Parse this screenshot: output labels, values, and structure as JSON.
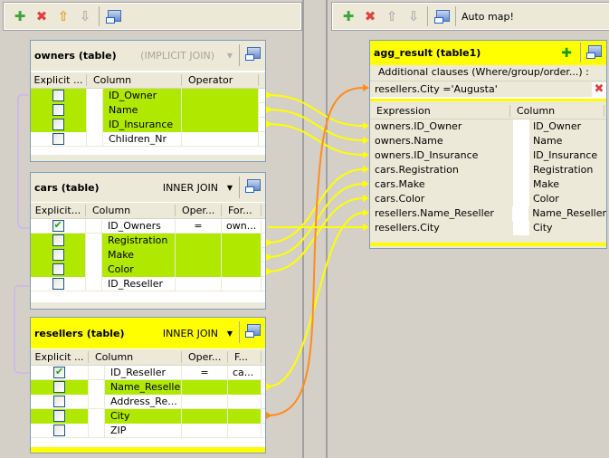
{
  "left_toolbar": {
    "buttons": [
      "add",
      "remove",
      "move-up",
      "move-down",
      "minimize"
    ]
  },
  "right_toolbar": {
    "auto_map": "Auto map!"
  },
  "tables": [
    {
      "id": "owners",
      "title": "owners  (table)",
      "join": "(IMPLICIT JOIN)",
      "join_disabled": true,
      "yellow": false,
      "headers": [
        "Explicit ...",
        "Column",
        "Operator"
      ],
      "rows": [
        {
          "checked": false,
          "column": "ID_Owner",
          "op": "",
          "for": "",
          "mapped": true
        },
        {
          "checked": false,
          "column": "Name",
          "op": "",
          "for": "",
          "mapped": true
        },
        {
          "checked": false,
          "column": "ID_Insurance",
          "op": "",
          "for": "",
          "mapped": true
        },
        {
          "checked": false,
          "column": "Chlidren_Nr",
          "op": "",
          "for": "",
          "mapped": false
        }
      ]
    },
    {
      "id": "cars",
      "title": "cars  (table)",
      "join": "INNER JOIN",
      "join_disabled": false,
      "yellow": false,
      "headers": [
        "Explicit...",
        "Column",
        "Oper...",
        "For..."
      ],
      "rows": [
        {
          "checked": true,
          "column": "ID_Owners",
          "op": "=",
          "for": "own...",
          "mapped": false
        },
        {
          "checked": false,
          "column": "Registration",
          "op": "",
          "for": "",
          "mapped": true
        },
        {
          "checked": false,
          "column": "Make",
          "op": "",
          "for": "",
          "mapped": true
        },
        {
          "checked": false,
          "column": "Color",
          "op": "",
          "for": "",
          "mapped": true
        },
        {
          "checked": false,
          "column": "ID_Reseller",
          "op": "",
          "for": "",
          "mapped": false
        }
      ]
    },
    {
      "id": "resellers",
      "title": "resellers  (table)",
      "join": "INNER JOIN",
      "join_disabled": false,
      "yellow": true,
      "headers": [
        "Explicit ...",
        "Column",
        "Oper...",
        "F..."
      ],
      "rows": [
        {
          "checked": true,
          "column": "ID_Reseller",
          "op": "=",
          "for": "ca...",
          "mapped": false
        },
        {
          "checked": false,
          "column": "Name_Reseller",
          "op": "",
          "for": "",
          "mapped": true
        },
        {
          "checked": false,
          "column": "Address_Re...",
          "op": "",
          "for": "",
          "mapped": false
        },
        {
          "checked": false,
          "column": "City",
          "op": "",
          "for": "",
          "mapped": true
        },
        {
          "checked": false,
          "column": "ZIP",
          "op": "",
          "for": "",
          "mapped": false
        }
      ]
    }
  ],
  "output": {
    "title": "agg_result (table1)",
    "clauses_label": "Additional clauses (Where/group/order...) :",
    "filter": "resellers.City ='Augusta'",
    "headers": [
      "Expression",
      "Column"
    ],
    "rows": [
      {
        "expr": "owners.ID_Owner",
        "col": "ID_Owner"
      },
      {
        "expr": "owners.Name",
        "col": "Name"
      },
      {
        "expr": "owners.ID_Insurance",
        "col": "ID_Insurance"
      },
      {
        "expr": "cars.Registration",
        "col": "Registration"
      },
      {
        "expr": "cars.Make",
        "col": "Make"
      },
      {
        "expr": "cars.Color",
        "col": "Color"
      },
      {
        "expr": "resellers.Name_Reseller",
        "col": "Name_Reseller"
      },
      {
        "expr": "resellers.City",
        "col": "City"
      }
    ]
  },
  "colors": {
    "mapped": "#b0e800",
    "link": "#ffff00",
    "filter_link": "#ff8c1a",
    "join_link": "#c8b8e8"
  }
}
